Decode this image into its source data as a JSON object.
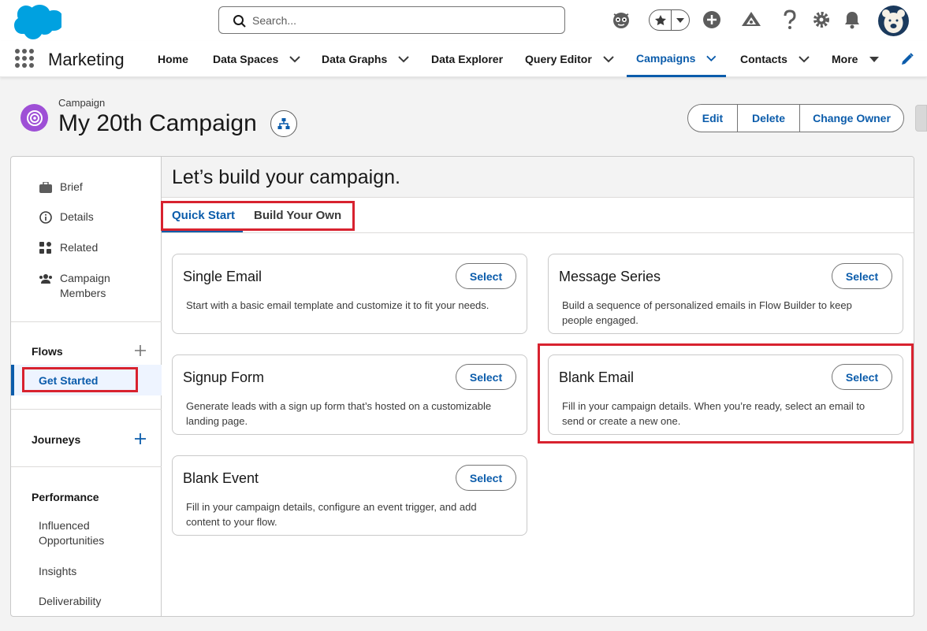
{
  "colors": {
    "brand": "#0b5cab",
    "campaign_icon": "#9e4fd6",
    "cloud": "#00a1e0",
    "highlight": "#d8222f"
  },
  "global_header": {
    "search_placeholder": "Search...",
    "icons": [
      "salesforce-logo",
      "einstein-icon",
      "favorites-star-icon",
      "add-icon",
      "trailhead-icon",
      "help-icon",
      "setup-gear-icon",
      "notifications-bell-icon",
      "user-avatar"
    ]
  },
  "nav": {
    "app_name": "Marketing",
    "items": [
      {
        "label": "Home",
        "dropdown": false
      },
      {
        "label": "Data Spaces",
        "dropdown": true
      },
      {
        "label": "Data Graphs",
        "dropdown": true
      },
      {
        "label": "Data Explorer",
        "dropdown": false
      },
      {
        "label": "Query Editor",
        "dropdown": true
      },
      {
        "label": "Campaigns",
        "dropdown": true,
        "active": true
      },
      {
        "label": "Contacts",
        "dropdown": true
      },
      {
        "label": "More",
        "dropdown": true
      }
    ]
  },
  "record": {
    "type": "Campaign",
    "title": "My 20th Campaign",
    "actions": [
      "Edit",
      "Delete",
      "Change Owner"
    ]
  },
  "sidebar": {
    "items": [
      {
        "label": "Brief",
        "icon": "briefcase-icon"
      },
      {
        "label": "Details",
        "icon": "info-icon"
      },
      {
        "label": "Related",
        "icon": "related-grid-icon"
      },
      {
        "label": "Campaign Members",
        "icon": "members-icon"
      }
    ],
    "flows_label": "Flows",
    "get_started_label": "Get Started",
    "journeys_label": "Journeys",
    "performance_label": "Performance",
    "performance_items": [
      "Influenced Opportunities",
      "Insights",
      "Deliverability"
    ]
  },
  "main": {
    "heading": "Let’s build your campaign.",
    "tabs": [
      "Quick Start",
      "Build Your Own"
    ],
    "active_tab": "Quick Start",
    "select_label": "Select",
    "options": [
      {
        "title": "Single Email",
        "desc": "Start with a basic email template and customize it to fit your needs."
      },
      {
        "title": "Message Series",
        "desc": "Build a sequence of personalized emails in Flow Builder to keep people engaged."
      },
      {
        "title": "Signup Form",
        "desc": "Generate leads with a sign up form that’s hosted on a customizable landing page."
      },
      {
        "title": "Blank Email",
        "desc": "Fill in your campaign details. When you’re ready, select an email to send or create a new one."
      },
      {
        "title": "Blank Event",
        "desc": "Fill in your campaign details, configure an event trigger, and add content to your flow."
      }
    ]
  }
}
